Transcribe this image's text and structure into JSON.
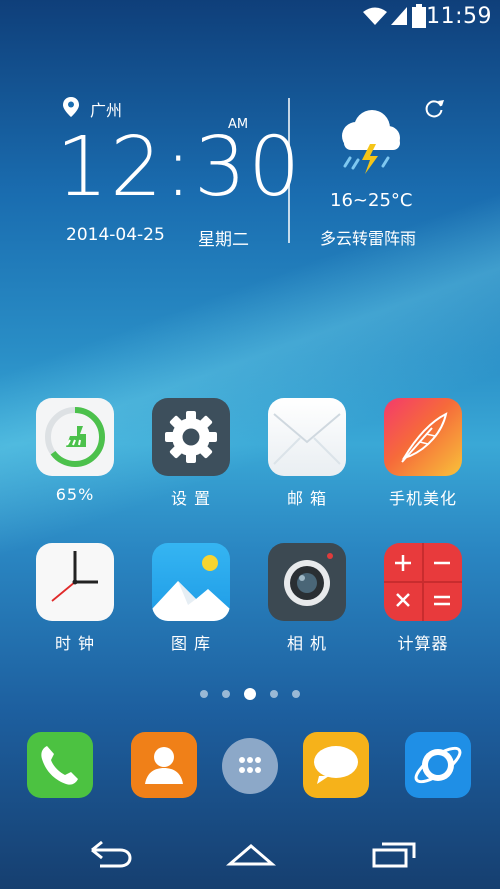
{
  "status_bar": {
    "time": "11:59",
    "icons": [
      "wifi-icon",
      "signal-icon",
      "battery-icon"
    ]
  },
  "weather_widget": {
    "city": "广州",
    "time": "12:30",
    "ampm": "AM",
    "date": "2014-04-25",
    "weekday": "星期二",
    "temperature": "16~25°C",
    "description": "多云转雷阵雨",
    "icons": [
      "location-icon",
      "refresh-icon",
      "thunderstorm-icon"
    ]
  },
  "apps": [
    {
      "label": "65%",
      "icon": "cleaner-icon",
      "progress": 0.65
    },
    {
      "label": "设 置",
      "icon": "settings-gear-icon"
    },
    {
      "label": "邮 箱",
      "icon": "mail-envelope-icon"
    },
    {
      "label": "手机美化",
      "icon": "feather-theme-icon"
    },
    {
      "label": "时 钟",
      "icon": "clock-icon"
    },
    {
      "label": "图 库",
      "icon": "gallery-icon"
    },
    {
      "label": "相 机",
      "icon": "camera-icon"
    },
    {
      "label": "计算器",
      "icon": "calculator-icon"
    }
  ],
  "page_indicator": {
    "total": 5,
    "active": 3
  },
  "dock": [
    "phone-icon",
    "contacts-icon",
    "app-drawer-icon",
    "messages-icon",
    "browser-icon"
  ],
  "nav_bar": [
    "back-icon",
    "home-icon",
    "recents-icon"
  ],
  "colors": {
    "settings": "#3d4f5c",
    "contacts": "#f08018",
    "phone": "#4cc241",
    "messages": "#f6b21a",
    "browser": "#1f8fe6",
    "calculator": "#e83a3c",
    "cleaner_ring": "#4cc14c"
  }
}
